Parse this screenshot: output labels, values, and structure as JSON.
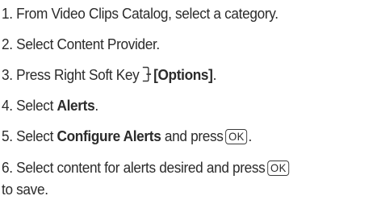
{
  "steps": [
    {
      "num": "1.",
      "text": "From Video Clips Catalog, select a category."
    },
    {
      "num": "2.",
      "text": "Select Content Provider."
    },
    {
      "num": "3.",
      "text_before": "Press Right Soft Key",
      "icon": "right-soft-key-icon",
      "bold": "[Options]",
      "text_after": "."
    },
    {
      "num": "4.",
      "text_before": "Select",
      "bold": "Alerts",
      "text_after": "."
    },
    {
      "num": "5.",
      "text_before": "Select",
      "bold": "Configure Alerts",
      "text_mid": "and press",
      "key": "OK",
      "text_after": "."
    },
    {
      "num": "6.",
      "text_before": "Select content for alerts desired and press",
      "key": "OK",
      "continuation": "to save."
    }
  ]
}
